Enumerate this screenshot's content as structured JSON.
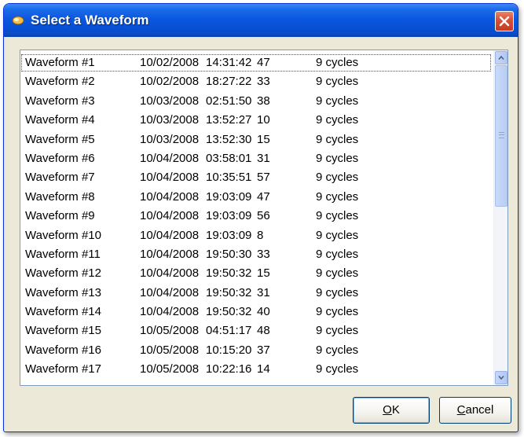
{
  "window": {
    "title": "Select a Waveform",
    "titlebar_color": "#0a58e0",
    "close_icon": "close-icon"
  },
  "waveform_list": {
    "selected_index": 0,
    "rows": [
      {
        "name": "Waveform #1",
        "date": "10/02/2008",
        "time": "14:31:42",
        "value": "47",
        "cycles": "9 cycles"
      },
      {
        "name": "Waveform #2",
        "date": "10/02/2008",
        "time": "18:27:22",
        "value": "33",
        "cycles": "9 cycles"
      },
      {
        "name": "Waveform #3",
        "date": "10/03/2008",
        "time": "02:51:50",
        "value": "38",
        "cycles": "9 cycles"
      },
      {
        "name": "Waveform #4",
        "date": "10/03/2008",
        "time": "13:52:27",
        "value": "10",
        "cycles": "9 cycles"
      },
      {
        "name": "Waveform #5",
        "date": "10/03/2008",
        "time": "13:52:30",
        "value": "15",
        "cycles": "9 cycles"
      },
      {
        "name": "Waveform #6",
        "date": "10/04/2008",
        "time": "03:58:01",
        "value": "31",
        "cycles": "9 cycles"
      },
      {
        "name": "Waveform #7",
        "date": "10/04/2008",
        "time": "10:35:51",
        "value": "57",
        "cycles": "9 cycles"
      },
      {
        "name": "Waveform #8",
        "date": "10/04/2008",
        "time": "19:03:09",
        "value": "47",
        "cycles": "9 cycles"
      },
      {
        "name": "Waveform #9",
        "date": "10/04/2008",
        "time": "19:03:09",
        "value": "56",
        "cycles": "9 cycles"
      },
      {
        "name": "Waveform #10",
        "date": "10/04/2008",
        "time": "19:03:09",
        "value": "8",
        "cycles": "9 cycles"
      },
      {
        "name": "Waveform #11",
        "date": "10/04/2008",
        "time": "19:50:30",
        "value": "33",
        "cycles": "9 cycles"
      },
      {
        "name": "Waveform #12",
        "date": "10/04/2008",
        "time": "19:50:32",
        "value": "15",
        "cycles": "9 cycles"
      },
      {
        "name": "Waveform #13",
        "date": "10/04/2008",
        "time": "19:50:32",
        "value": "31",
        "cycles": "9 cycles"
      },
      {
        "name": "Waveform #14",
        "date": "10/04/2008",
        "time": "19:50:32",
        "value": "40",
        "cycles": "9 cycles"
      },
      {
        "name": "Waveform #15",
        "date": "10/05/2008",
        "time": "04:51:17",
        "value": "48",
        "cycles": "9 cycles"
      },
      {
        "name": "Waveform #16",
        "date": "10/05/2008",
        "time": "10:15:20",
        "value": "37",
        "cycles": "9 cycles"
      },
      {
        "name": "Waveform #17",
        "date": "10/05/2008",
        "time": "10:22:16",
        "value": "14",
        "cycles": "9 cycles"
      }
    ]
  },
  "scrollbar": {
    "up_icon": "scroll-up-arrow-icon",
    "down_icon": "scroll-down-arrow-icon"
  },
  "buttons": {
    "ok": {
      "mnemonic": "O",
      "rest": "K"
    },
    "cancel": {
      "mnemonic": "C",
      "rest": "ancel"
    }
  }
}
